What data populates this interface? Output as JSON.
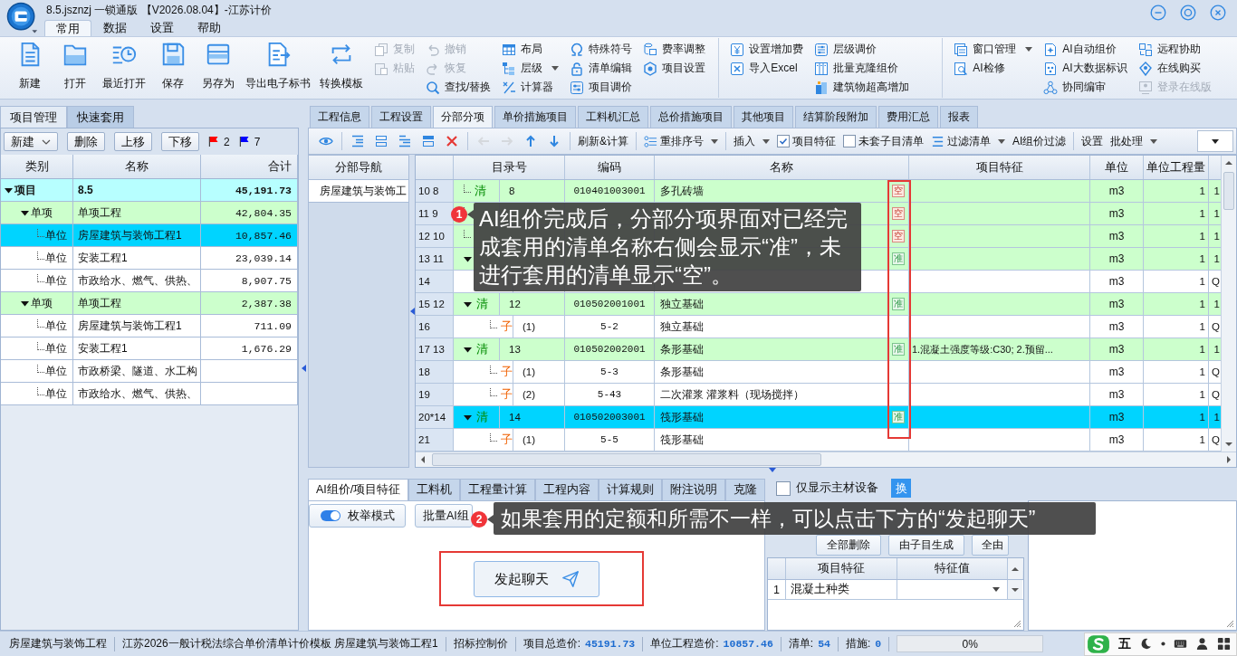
{
  "window": {
    "title": "8.5.jsznzj 一锁通版 【V2026.08.04】-江苏计价"
  },
  "menu_tabs": [
    {
      "label": "常用",
      "selected": true
    },
    {
      "label": "数据",
      "selected": false
    },
    {
      "label": "设置",
      "selected": false
    },
    {
      "label": "帮助",
      "selected": false
    }
  ],
  "ribbon": {
    "large_buttons": [
      {
        "label": "新建"
      },
      {
        "label": "打开"
      },
      {
        "label": "最近打开"
      },
      {
        "label": "保存"
      },
      {
        "label": "另存为"
      },
      {
        "label": "导出电子标书"
      },
      {
        "label": "转换模板"
      }
    ],
    "groups": [
      {
        "columns": [
          [
            {
              "label": "复制",
              "disabled": true,
              "dropdown": false
            },
            {
              "label": "粘贴",
              "disabled": true,
              "dropdown": false
            }
          ],
          [
            {
              "label": "撤销",
              "disabled": true,
              "dropdown": false
            },
            {
              "label": "恢复",
              "disabled": true,
              "dropdown": false
            },
            {
              "label": "查找/替换",
              "disabled": false,
              "dropdown": false
            }
          ],
          [
            {
              "label": "布局",
              "disabled": false,
              "dropdown": false
            },
            {
              "label": "层级",
              "disabled": false,
              "dropdown": true
            },
            {
              "label": "计算器",
              "disabled": false,
              "dropdown": false
            }
          ],
          [
            {
              "label": "特殊符号",
              "disabled": false,
              "dropdown": false
            },
            {
              "label": "清单编辑",
              "disabled": false,
              "dropdown": false
            },
            {
              "label": "项目调价",
              "disabled": false,
              "dropdown": false
            }
          ],
          [
            {
              "label": "费率调整",
              "disabled": false,
              "dropdown": false
            },
            {
              "label": "项目设置",
              "disabled": false,
              "dropdown": false
            }
          ]
        ]
      },
      {
        "columns": [
          [
            {
              "label": "设置增加费",
              "disabled": false,
              "dropdown": false
            },
            {
              "label": "导入Excel",
              "disabled": false,
              "dropdown": false
            }
          ],
          [
            {
              "label": "层级调价",
              "disabled": false,
              "dropdown": false
            },
            {
              "label": "批量克隆组价",
              "disabled": false,
              "dropdown": false
            },
            {
              "label": "建筑物超高增加",
              "disabled": false,
              "dropdown": false
            }
          ]
        ]
      },
      {
        "columns": [
          [
            {
              "label": "窗口管理",
              "disabled": false,
              "dropdown": true
            },
            {
              "label": "AI检修",
              "disabled": false,
              "dropdown": false
            }
          ],
          [
            {
              "label": "AI自动组价",
              "disabled": false,
              "dropdown": false
            },
            {
              "label": "AI大数据标识",
              "disabled": false,
              "dropdown": false
            },
            {
              "label": "协同编审",
              "disabled": false,
              "dropdown": false
            }
          ],
          [
            {
              "label": "远程协助",
              "disabled": false,
              "dropdown": false
            },
            {
              "label": "在线购买",
              "disabled": false,
              "dropdown": false
            },
            {
              "label": "登录在线版",
              "disabled": true,
              "dropdown": false
            }
          ]
        ]
      }
    ]
  },
  "left_panel": {
    "tabs": [
      {
        "label": "项目管理",
        "selected": true
      },
      {
        "label": "快速套用",
        "selected": false
      }
    ],
    "toolbar": {
      "buttons": [
        {
          "label": "新建",
          "dropdown": true
        },
        {
          "label": "删除",
          "dropdown": false
        },
        {
          "label": "上移",
          "dropdown": false
        },
        {
          "label": "下移",
          "dropdown": false
        }
      ],
      "flags": [
        {
          "color": "#ff0000",
          "count": "2"
        },
        {
          "color": "#0000ff",
          "count": "7"
        }
      ]
    },
    "tree": {
      "columns": [
        "类别",
        "名称",
        "合计"
      ],
      "nodes": [
        {
          "category": "项目",
          "name": "8.5",
          "total": "45,191.73",
          "selected": false,
          "expanded": true,
          "children": [
            {
              "category": "单项",
              "name": "单项工程",
              "total": "42,804.35",
              "selected": false,
              "expanded": true,
              "children": [
                {
                  "category": "单位",
                  "name": "房屋建筑与装饰工程1",
                  "total": "10,857.46",
                  "selected": true
                },
                {
                  "category": "单位",
                  "name": "安装工程1",
                  "total": "23,039.14",
                  "selected": false
                },
                {
                  "category": "单位",
                  "name": "市政给水、燃气、供热、",
                  "total": "8,907.75",
                  "selected": false
                }
              ]
            },
            {
              "category": "单项",
              "name": "单项工程",
              "total": "2,387.38",
              "selected": false,
              "expanded": true,
              "children": [
                {
                  "category": "单位",
                  "name": "房屋建筑与装饰工程1",
                  "total": "711.09",
                  "selected": false
                },
                {
                  "category": "单位",
                  "name": "安装工程1",
                  "total": "1,676.29",
                  "selected": false
                },
                {
                  "category": "单位",
                  "name": "市政桥梁、隧道、水工构",
                  "selected": false
                },
                {
                  "category": "单位",
                  "name": "市政给水、燃气、供热、",
                  "selected": false
                }
              ]
            }
          ]
        }
      ]
    }
  },
  "main": {
    "tabs": [
      {
        "label": "工程信息",
        "selected": false
      },
      {
        "label": "工程设置",
        "selected": false
      },
      {
        "label": "分部分项",
        "selected": true
      },
      {
        "label": "单价措施项目",
        "selected": false
      },
      {
        "label": "工料机汇总",
        "selected": false
      },
      {
        "label": "总价措施项目",
        "selected": false
      },
      {
        "label": "其他项目",
        "selected": false
      },
      {
        "label": "结算阶段附加",
        "selected": false
      },
      {
        "label": "费用汇总",
        "selected": false
      },
      {
        "label": "报表",
        "selected": false
      }
    ],
    "toolbar": [
      [
        {
          "kind": "icon",
          "disabled": false
        }
      ],
      [
        {
          "kind": "icon",
          "disabled": false
        },
        {
          "kind": "icon",
          "disabled": false
        },
        {
          "kind": "icon",
          "disabled": false
        },
        {
          "kind": "icon",
          "disabled": false
        },
        {
          "kind": "icon",
          "disabled": false
        }
      ],
      [
        {
          "kind": "icon",
          "disabled": true
        },
        {
          "kind": "icon",
          "disabled": true
        },
        {
          "kind": "icon",
          "disabled": false
        },
        {
          "kind": "icon",
          "disabled": false
        }
      ],
      [
        {
          "kind": "button",
          "label": "刷新&计算",
          "dropdown": false
        }
      ],
      [
        {
          "kind": "icon_button",
          "label": "重排序号",
          "dropdown": true
        }
      ],
      [
        {
          "kind": "button",
          "label": "插入",
          "dropdown": true
        },
        {
          "kind": "checkbox",
          "label": "项目特征",
          "checked": true
        },
        {
          "kind": "checkbox",
          "label": "未套子目清单",
          "checked": false
        },
        {
          "kind": "icon_button",
          "label": "过滤清单",
          "dropdown": true
        },
        {
          "kind": "button",
          "label": "AI组价过滤",
          "dropdown": false
        }
      ],
      [
        {
          "kind": "button",
          "label": "设置",
          "dropdown": false
        },
        {
          "kind": "button",
          "label": "批处理",
          "dropdown": true
        }
      ]
    ],
    "nav": {
      "header": "分部导航",
      "items": [
        {
          "label": "房屋建筑与装饰工"
        }
      ]
    },
    "grid": {
      "columns": [
        "目录号",
        "编码",
        "名称",
        "项目特征",
        "单位",
        "单位工程量"
      ],
      "rows": [
        {
          "number": "10 8",
          "kind": "list",
          "type_label": "清",
          "catalog": "8",
          "code": "010401003001",
          "name": "多孔砖墙",
          "status": {
            "label": "空",
            "kind": "unpriced"
          },
          "unit": "m3",
          "quantity": "1",
          "column_9": "1",
          "selected": false
        },
        {
          "number": "11 9",
          "kind": "list",
          "status": {
            "label": "空",
            "kind": "unpriced"
          },
          "unit": "m3",
          "quantity": "1",
          "column_9": "1",
          "selected": false
        },
        {
          "number": "12 10",
          "kind": "list",
          "status": {
            "label": "空",
            "kind": "unpriced"
          },
          "unit": "m3",
          "quantity": "1",
          "column_9": "1",
          "selected": false
        },
        {
          "number": "13 11",
          "kind": "list",
          "expanded": true,
          "status": {
            "label": "准",
            "kind": "priced"
          },
          "unit": "m3",
          "quantity": "1",
          "column_9": "1",
          "selected": false
        },
        {
          "number": "14",
          "kind": "item",
          "unit": "m3",
          "quantity": "1",
          "column_9": "Q",
          "selected": false
        },
        {
          "number": "15 12",
          "kind": "list",
          "expanded": true,
          "type_label": "清",
          "catalog": "12",
          "code": "010502001001",
          "name": "独立基础",
          "status": {
            "label": "准",
            "kind": "priced"
          },
          "unit": "m3",
          "quantity": "1",
          "column_9": "1",
          "selected": false
        },
        {
          "number": "16",
          "kind": "item",
          "type_label": "子",
          "catalog": "(1)",
          "code": "5-2",
          "name": "独立基础",
          "unit": "m3",
          "quantity": "1",
          "column_9": "Q",
          "selected": false
        },
        {
          "number": "17 13",
          "kind": "list",
          "expanded": true,
          "type_label": "清",
          "catalog": "13",
          "code": "010502002001",
          "name": "条形基础",
          "status": {
            "label": "准",
            "kind": "priced"
          },
          "feature": "1.混凝土强度等级:C30; 2.预留...",
          "unit": "m3",
          "quantity": "1",
          "column_9": "1",
          "selected": false
        },
        {
          "number": "18",
          "kind": "item",
          "type_label": "子",
          "catalog": "(1)",
          "code": "5-3",
          "name": "条形基础",
          "unit": "m3",
          "quantity": "1",
          "column_9": "Q",
          "selected": false
        },
        {
          "number": "19",
          "kind": "item",
          "type_label": "子",
          "catalog": "(2)",
          "code": "5-43",
          "name": "二次灌浆 灌浆料（现场搅拌）",
          "unit": "m3",
          "quantity": "1",
          "column_9": "Q",
          "selected": false
        },
        {
          "number": "20*14",
          "kind": "list",
          "expanded": true,
          "type_label": "清",
          "catalog": "14",
          "code": "010502003001",
          "name": "筏形基础",
          "status": {
            "label": "准",
            "kind": "priced"
          },
          "unit": "m3",
          "quantity": "1",
          "column_9": "1",
          "selected": true
        },
        {
          "number": "21",
          "kind": "item",
          "type_label": "子",
          "catalog": "(1)",
          "code": "5-5",
          "name": "筏形基础",
          "unit": "m3",
          "quantity": "1",
          "column_9": "Q",
          "selected": false
        }
      ]
    }
  },
  "bottom": {
    "tabs": [
      {
        "label": "AI组价/项目特征",
        "selected": true
      },
      {
        "label": "工料机",
        "selected": false
      },
      {
        "label": "工程量计算",
        "selected": false
      },
      {
        "label": "工程内容",
        "selected": false
      },
      {
        "label": "计算规则",
        "selected": false
      },
      {
        "label": "附注说明",
        "selected": false
      },
      {
        "label": "克隆",
        "selected": false
      }
    ],
    "main_material_checkbox": {
      "label": "仅显示主材设备",
      "checked": false
    },
    "swap_button": {
      "label": "换"
    },
    "mode_toggle": {
      "label": "枚举模式",
      "on": true
    },
    "batch_button": {
      "label": "批量AI组"
    },
    "chat_button": {
      "label": "发起聊天"
    },
    "feature_panel": {
      "buttons": [
        {
          "label": "全部删除"
        },
        {
          "label": "由子目生成"
        },
        {
          "label": "全由"
        }
      ],
      "columns": [
        "项目特征",
        "特征值"
      ],
      "rows": [
        {
          "number": "1",
          "feature": "混凝土种类"
        }
      ]
    }
  },
  "annotations": [
    {
      "number": "1",
      "text": "AI组价完成后，分部分项界面对已经完成套用的清单名称右侧会显示“准”，未进行套用的清单显示“空”。"
    },
    {
      "number": "2",
      "text": "如果套用的定额和所需不一样，可以点击下方的“发起聊天”"
    }
  ],
  "status_bar": {
    "items": [
      {
        "kind": "text",
        "text": "房屋建筑与装饰工程"
      },
      {
        "kind": "text",
        "text": "江苏2026一般计税法综合单价清单计价模板 房屋建筑与装饰工程1"
      },
      {
        "kind": "text",
        "text": "招标控制价"
      },
      {
        "kind": "metric",
        "label": "项目总造价:",
        "value": "45191.73"
      },
      {
        "kind": "metric",
        "label": "单位工程造价:",
        "value": "10857.46"
      },
      {
        "kind": "metric",
        "label": "清单:",
        "value": "54"
      },
      {
        "kind": "metric",
        "label": "措施:",
        "value": "0"
      }
    ],
    "progress": {
      "level": 0,
      "reading": "0%"
    },
    "ime": {
      "mode": "五"
    }
  }
}
